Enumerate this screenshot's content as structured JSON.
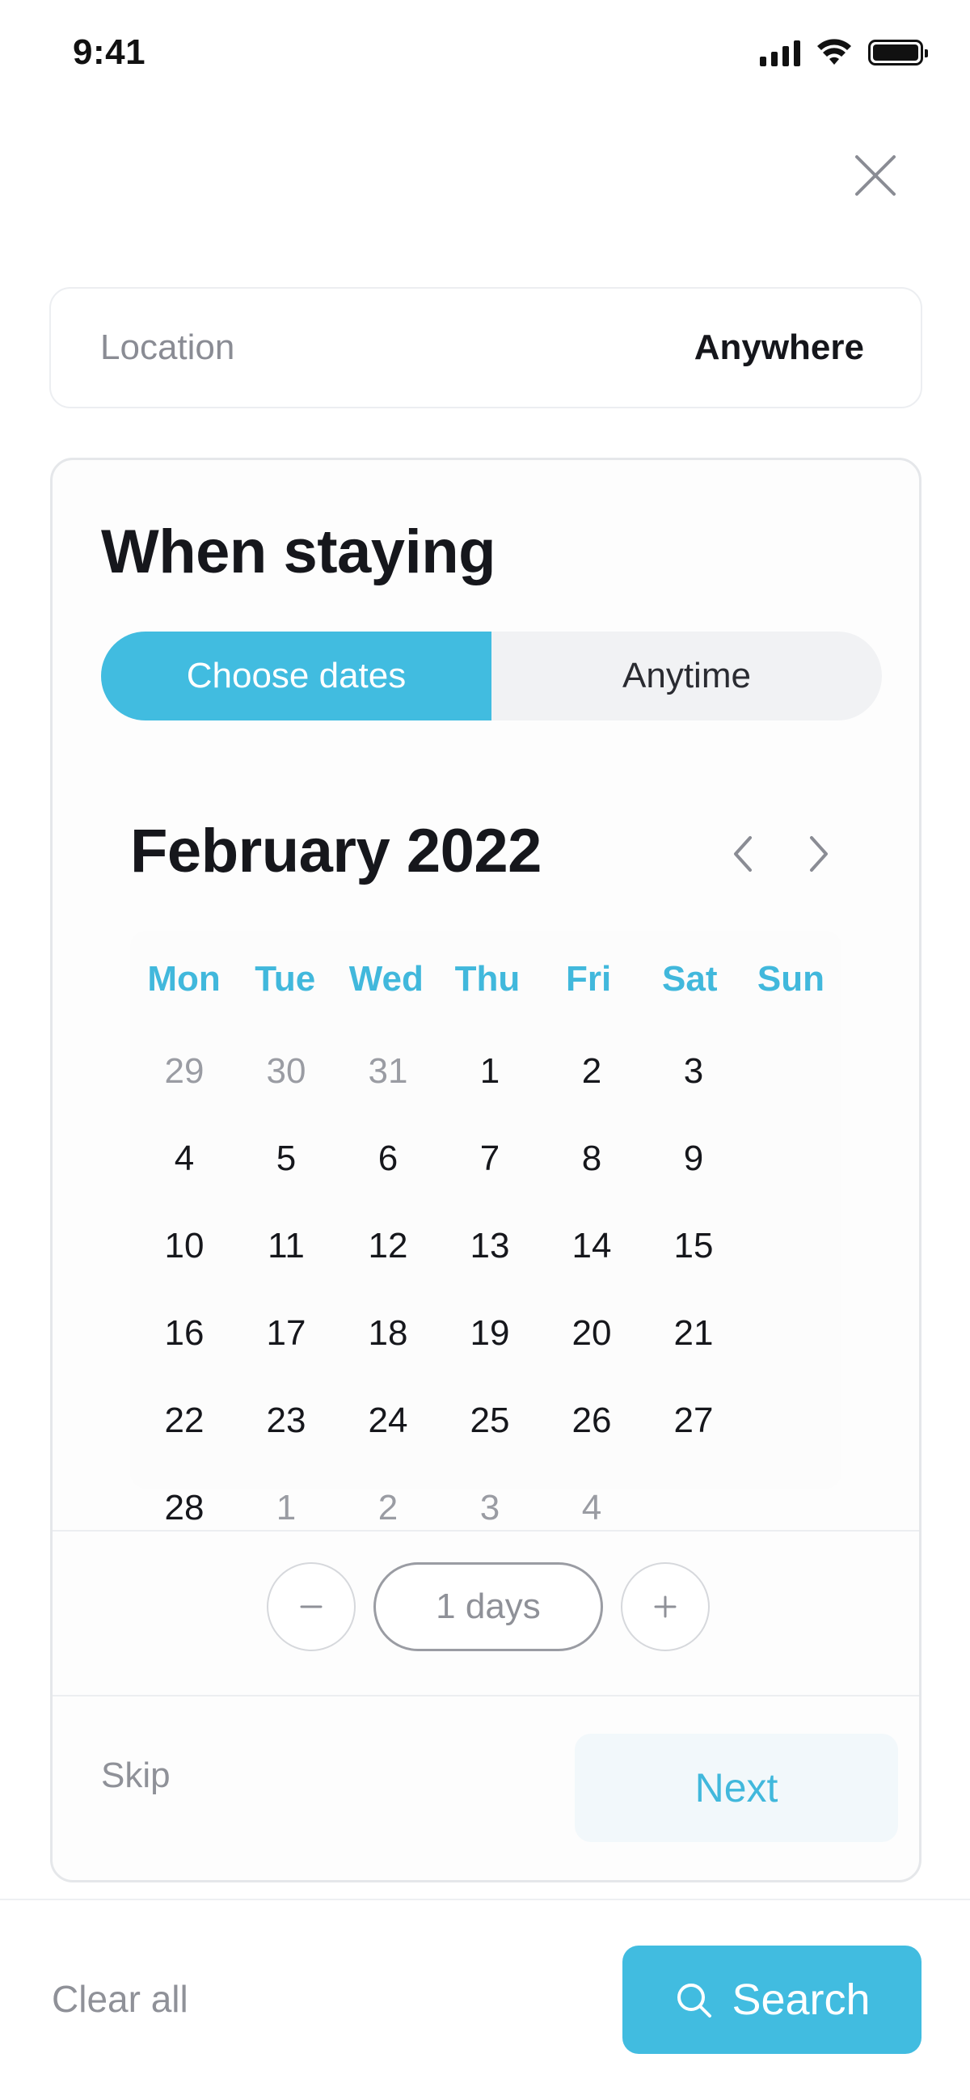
{
  "status_bar": {
    "time": "9:41"
  },
  "location": {
    "label": "Location",
    "value": "Anywhere"
  },
  "when": {
    "title": "When staying",
    "tabs": [
      {
        "label": "Choose dates",
        "active": true
      },
      {
        "label": "Anytime",
        "active": false
      }
    ]
  },
  "calendar": {
    "month_title": "February 2022",
    "weekdays": [
      "Mon",
      "Tue",
      "Wed",
      "Thu",
      "Fri",
      "Sat",
      "Sun"
    ],
    "days": [
      {
        "label": "29",
        "in_month": false
      },
      {
        "label": "30",
        "in_month": false
      },
      {
        "label": "31",
        "in_month": false
      },
      {
        "label": "1",
        "in_month": true
      },
      {
        "label": "2",
        "in_month": true
      },
      {
        "label": "3",
        "in_month": true
      },
      {
        "label": "4",
        "in_month": true
      },
      {
        "label": "5",
        "in_month": true
      },
      {
        "label": "6",
        "in_month": true
      },
      {
        "label": "7",
        "in_month": true
      },
      {
        "label": "8",
        "in_month": true
      },
      {
        "label": "9",
        "in_month": true
      },
      {
        "label": "10",
        "in_month": true
      },
      {
        "label": "11",
        "in_month": true
      },
      {
        "label": "12",
        "in_month": true
      },
      {
        "label": "13",
        "in_month": true
      },
      {
        "label": "14",
        "in_month": true
      },
      {
        "label": "15",
        "in_month": true
      },
      {
        "label": "16",
        "in_month": true
      },
      {
        "label": "17",
        "in_month": true
      },
      {
        "label": "18",
        "in_month": true
      },
      {
        "label": "19",
        "in_month": true
      },
      {
        "label": "20",
        "in_month": true
      },
      {
        "label": "21",
        "in_month": true
      },
      {
        "label": "22",
        "in_month": true
      },
      {
        "label": "23",
        "in_month": true
      },
      {
        "label": "24",
        "in_month": true
      },
      {
        "label": "25",
        "in_month": true
      },
      {
        "label": "26",
        "in_month": true
      },
      {
        "label": "27",
        "in_month": true
      },
      {
        "label": "28",
        "in_month": true
      },
      {
        "label": "1",
        "in_month": false
      },
      {
        "label": "2",
        "in_month": false
      },
      {
        "label": "3",
        "in_month": false
      },
      {
        "label": "4",
        "in_month": false
      }
    ]
  },
  "duration": {
    "minus": "−",
    "value": "1 days",
    "plus": "+"
  },
  "card_actions": {
    "skip": "Skip",
    "next": "Next"
  },
  "footer": {
    "clear_all": "Clear all",
    "search": "Search"
  },
  "colors": {
    "accent": "#41bce0",
    "text": "#16171c",
    "muted": "#8f9198"
  },
  "icons": {
    "close": "close-icon",
    "prev": "chevron-left-icon",
    "next": "chevron-right-icon",
    "search": "search-icon",
    "signal": "cellular-signal-icon",
    "wifi": "wifi-icon",
    "battery": "battery-icon"
  }
}
